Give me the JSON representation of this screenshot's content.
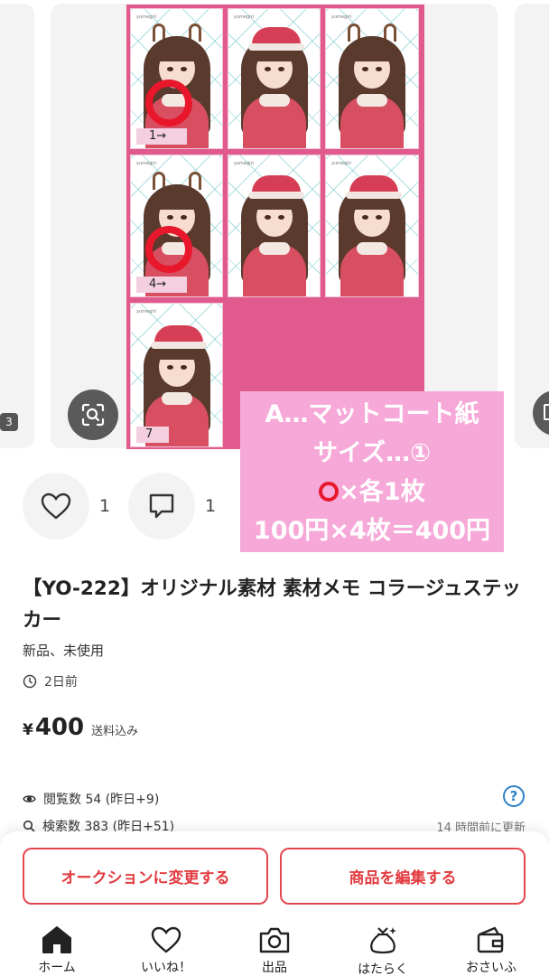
{
  "carousel": {
    "prev_page_indicator": "3",
    "sheet_number_labels": [
      "1→",
      "4→",
      "7"
    ],
    "watermark": "yumegiri",
    "overlay_lines": [
      "A…マットコート紙",
      "サイズ…①",
      "×各1枚",
      "100円×4枚＝400円"
    ]
  },
  "social": {
    "like_count": "1",
    "comment_count": "1"
  },
  "item": {
    "title": "【YO-222】オリジナル素材 素材メモ コラージュステッカー",
    "condition": "新品、未使用",
    "posted": "2日前",
    "price_symbol": "¥",
    "price": "400",
    "shipping": "送料込み"
  },
  "stats": {
    "views": "閲覧数  54 (昨日+9)",
    "searches": "検索数  383 (昨日+51)",
    "updated": "14 時間前に更新"
  },
  "actions": {
    "auction": "オークションに変更する",
    "edit": "商品を編集する"
  },
  "tabs": [
    "ホーム",
    "いいね！",
    "出品",
    "はたらく",
    "おさいふ"
  ],
  "colors": {
    "accent": "#e4474f",
    "sheet_pink": "#e05a8e",
    "note_pink": "#f6a9d8",
    "ring_red": "#e8172c"
  }
}
